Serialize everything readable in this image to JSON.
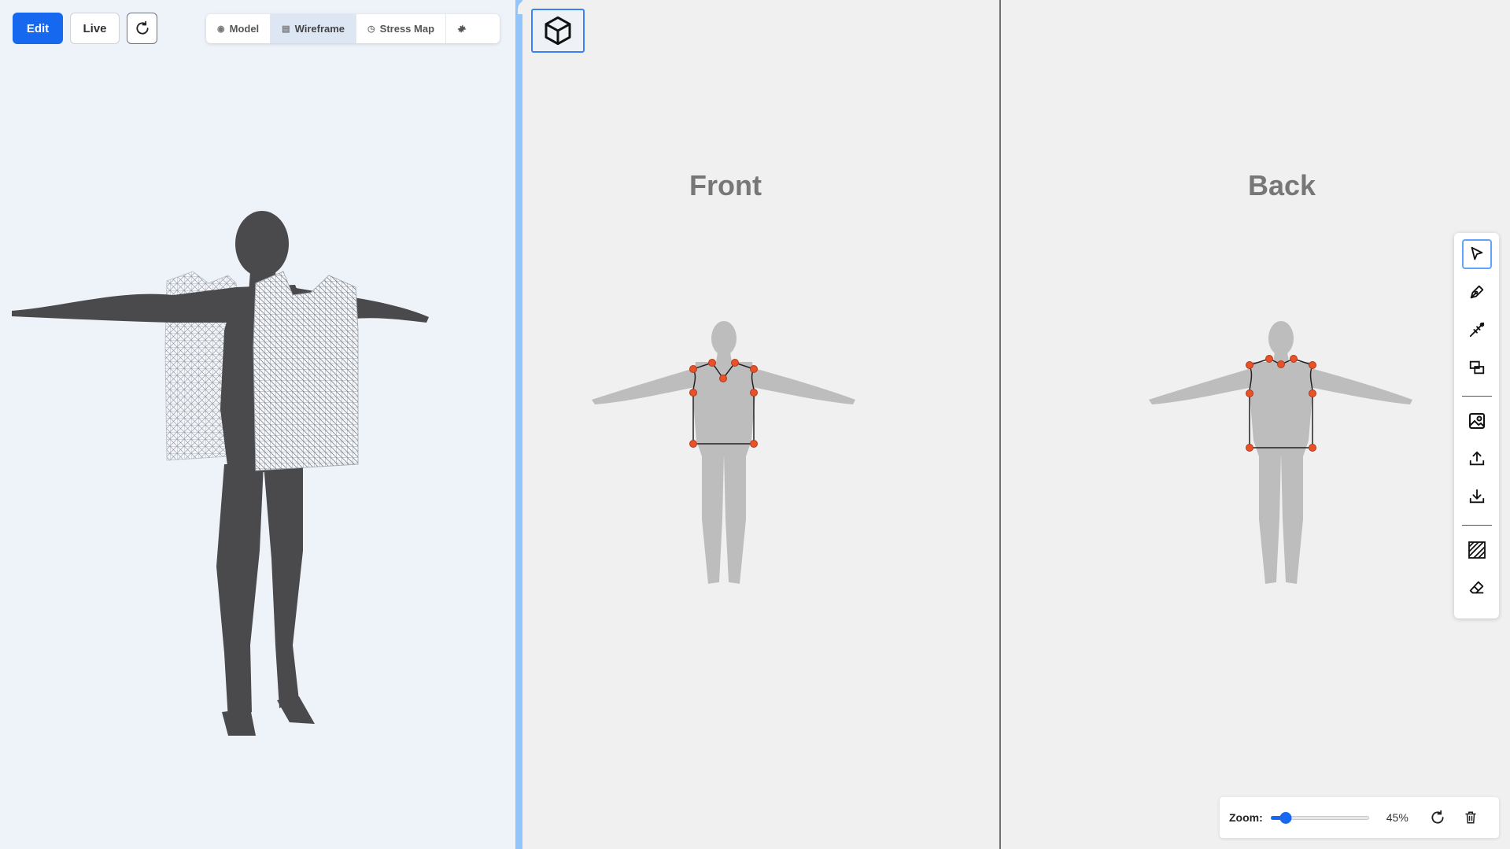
{
  "top_bar": {
    "edit_label": "Edit",
    "live_label": "Live",
    "reset_icon": "rotate-icon"
  },
  "view_modes": [
    {
      "label": "Model",
      "icon": "globe-icon",
      "active": false
    },
    {
      "label": "Wireframe",
      "icon": "grid-icon",
      "active": true
    },
    {
      "label": "Stress Map",
      "icon": "gauge-icon",
      "active": false
    }
  ],
  "settings_icon": "gear-icon",
  "pattern": {
    "front_title": "Front",
    "back_title": "Back"
  },
  "tools": [
    {
      "name": "select",
      "icon": "cursor-icon",
      "active": true
    },
    {
      "name": "pen",
      "icon": "pen-icon",
      "active": false
    },
    {
      "name": "seam",
      "icon": "seam-icon",
      "active": false
    },
    {
      "name": "layers",
      "icon": "layers-icon",
      "active": false
    },
    {
      "name": "image",
      "icon": "image-icon",
      "active": false
    },
    {
      "name": "upload",
      "icon": "upload-icon",
      "active": false
    },
    {
      "name": "download",
      "icon": "download-icon",
      "active": false
    },
    {
      "name": "fabric",
      "icon": "hatch-icon",
      "active": false
    },
    {
      "name": "eraser",
      "icon": "eraser-icon",
      "active": false
    }
  ],
  "zoom": {
    "label": "Zoom:",
    "value_text": "45%",
    "fraction": 0.1
  },
  "colors": {
    "accent": "#1668ef",
    "handle": "#e8512a",
    "divider": "#93c5fd"
  }
}
